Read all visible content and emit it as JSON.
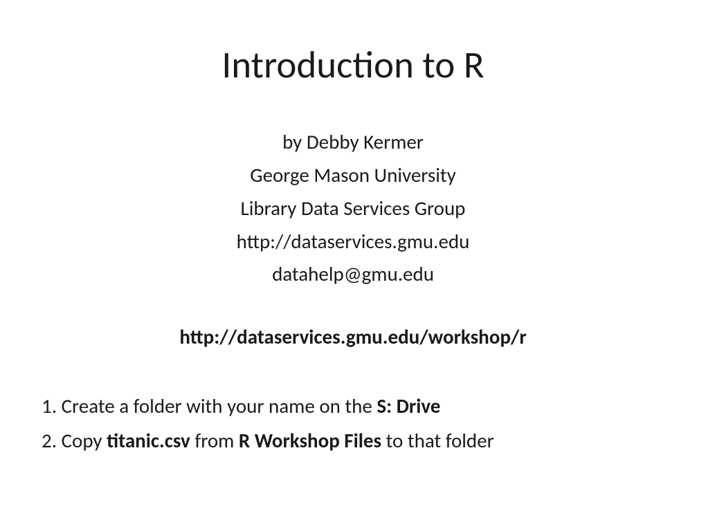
{
  "title": "Introduction to R",
  "info": {
    "author_line": "by Debby Kermer",
    "university": "George Mason University",
    "group": "Library Data Services Group",
    "url": "http://dataservices.gmu.edu",
    "email": "datahelp@gmu.edu"
  },
  "workshop_url": "http://dataservices.gmu.edu/workshop/r",
  "instructions": {
    "line1_prefix": "1. Create a folder with your name on the ",
    "line1_bold": "S: Drive",
    "line2_prefix": "2. Copy ",
    "line2_bold1": "titanic.csv",
    "line2_mid": " from ",
    "line2_bold2": "R Workshop Files",
    "line2_suffix": " to that folder"
  }
}
